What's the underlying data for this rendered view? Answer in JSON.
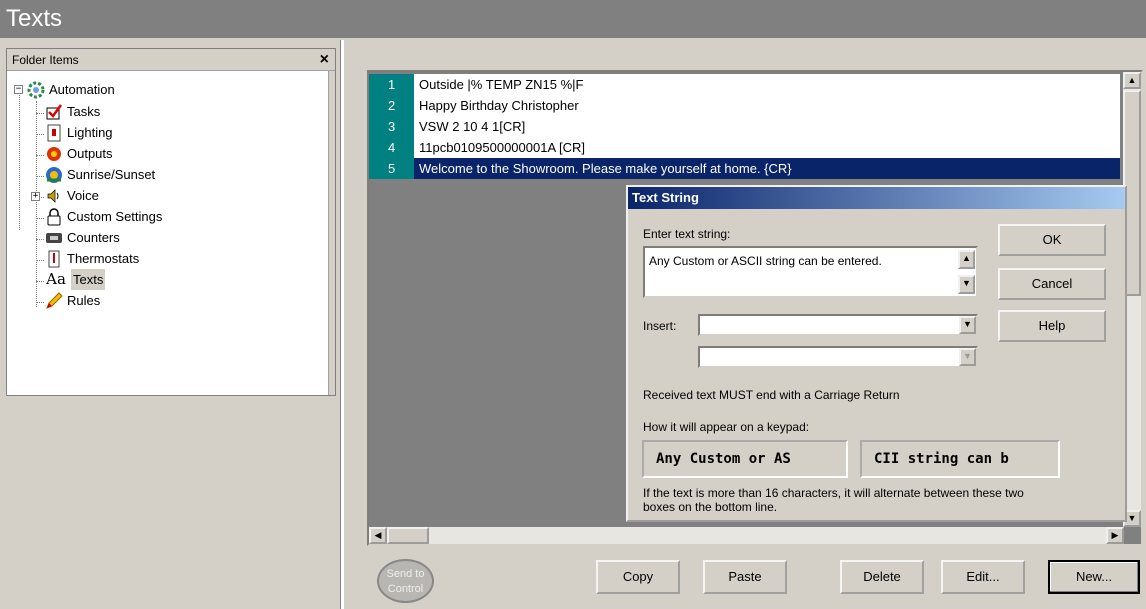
{
  "window": {
    "title": "Texts"
  },
  "folder_pane": {
    "header": "Folder Items",
    "close_glyph": "×",
    "root": {
      "label": "Automation",
      "icon": "gear-icon",
      "expander": "−"
    },
    "items": [
      {
        "label": "Tasks",
        "icon": "checkbox-icon"
      },
      {
        "label": "Lighting",
        "icon": "lightswitch-icon"
      },
      {
        "label": "Outputs",
        "icon": "output-icon"
      },
      {
        "label": "Sunrise/Sunset",
        "icon": "sun-icon"
      },
      {
        "label": "Voice",
        "icon": "speaker-icon",
        "expander": "+"
      },
      {
        "label": "Custom Settings",
        "icon": "lock-icon"
      },
      {
        "label": "Counters",
        "icon": "counter-icon"
      },
      {
        "label": "Thermostats",
        "icon": "thermostat-icon"
      },
      {
        "label": "Texts",
        "icon": "text-icon",
        "icon_text": "Aa",
        "selected": true
      },
      {
        "label": "Rules",
        "icon": "pencil-icon"
      }
    ]
  },
  "text_list": {
    "rows": [
      {
        "num": "1",
        "text": " Outside |% TEMP ZN15 %|F"
      },
      {
        "num": "2",
        "text": "Happy Birthday  Christopher"
      },
      {
        "num": "3",
        "text": "VSW 2 10 4 1[CR]"
      },
      {
        "num": "4",
        "text": "11pcb0109500000001A [CR]"
      },
      {
        "num": "5",
        "text": "Welcome to the Showroom.  Please make yourself at home. {CR}",
        "selected": true
      }
    ]
  },
  "buttons": {
    "send": "Send to Control",
    "copy": "Copy",
    "paste": "Paste",
    "delete": "Delete",
    "edit": "Edit...",
    "new": "New..."
  },
  "dialog": {
    "title": "Text String",
    "enter_label": "Enter text string:",
    "text_value": "Any Custom or ASCII string can be entered.",
    "insert_label": "Insert:",
    "insert_value_1": "",
    "insert_value_2": "",
    "received_note": "Received text MUST end with a Carriage Return",
    "keypad_label": "How it will appear on a keypad:",
    "keypad_box_1": "Any Custom or AS",
    "keypad_box_2": "CII string can b",
    "footnote": "If the text is more than 16 characters, it will alternate between these two boxes on the bottom line.",
    "ok": "OK",
    "cancel": "Cancel",
    "help": "Help"
  },
  "colors": {
    "row_number_bg": "#008080",
    "selection_bg": "#0a246a",
    "title_bar_bg": "#808080"
  }
}
